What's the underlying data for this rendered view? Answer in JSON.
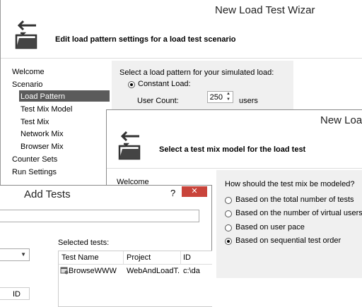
{
  "wizard1": {
    "title": "New Load Test Wizar",
    "heading": "Edit load pattern settings for a load test scenario",
    "nav": [
      "Welcome",
      "Scenario",
      "Load Pattern",
      "Test Mix Model",
      "Test Mix",
      "Network Mix",
      "Browser Mix",
      "Counter Sets",
      "Run Settings"
    ],
    "selected_nav": "Load Pattern",
    "pattern_prompt": "Select a load pattern for your simulated load:",
    "constant_load_label": "Constant Load:",
    "user_count_label": "User Count:",
    "user_count_value": "250",
    "users_unit": "users"
  },
  "wizard2": {
    "title": "New Load",
    "heading": "Select a test mix model for the load test",
    "nav_welcome": "Welcome",
    "prompt": "How should the test mix be modeled?",
    "options": [
      "Based on the total number of tests",
      "Based on the number of virtual users",
      "Based on user pace",
      "Based on sequential test order"
    ],
    "selected_option": "Based on sequential test order"
  },
  "add_tests": {
    "title": "Add Tests",
    "help": "?",
    "close": "✕",
    "selected_tests_label": "Selected tests:",
    "columns": [
      "Test Name",
      "Project",
      "ID"
    ],
    "rows": [
      {
        "name": "BrowseWWW",
        "project": "WebAndLoadT...",
        "id": "c:\\da"
      }
    ],
    "left_column_header": "ID"
  },
  "colors": {
    "selection": "#5b5b5b",
    "close_button": "#c9443b",
    "panel": "#f0f0f0"
  }
}
